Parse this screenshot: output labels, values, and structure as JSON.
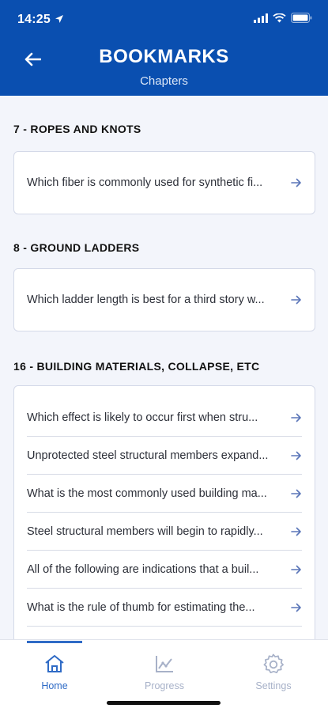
{
  "status": {
    "time": "14:25"
  },
  "header": {
    "title": "BOOKMARKS",
    "subtitle": "Chapters"
  },
  "sections": [
    {
      "title": "7 - ROPES AND KNOTS",
      "items": [
        "Which fiber is commonly used for synthetic fi..."
      ]
    },
    {
      "title": "8 - GROUND LADDERS",
      "items": [
        "Which ladder length is best for a third story w..."
      ]
    },
    {
      "title": "16 - BUILDING MATERIALS, COLLAPSE, ETC",
      "items": [
        "Which effect is likely to occur first when stru...",
        "Unprotected steel structural members expand...",
        "What is the most commonly used building ma...",
        "Steel structural members will begin to rapidly...",
        "All of the following are indications that a buil...",
        "What is the rule of thumb for estimating the..."
      ]
    }
  ],
  "tabs": [
    {
      "label": "Home",
      "icon": "home-icon",
      "active": true
    },
    {
      "label": "Progress",
      "icon": "progress-chart-icon",
      "active": false
    },
    {
      "label": "Settings",
      "icon": "gear-icon",
      "active": false
    }
  ],
  "colors": {
    "header_bg": "#0a4fb0",
    "active_tab": "#2f6bc6",
    "inactive_tab": "#a7b1c8",
    "arrow": "#5a75b8"
  }
}
